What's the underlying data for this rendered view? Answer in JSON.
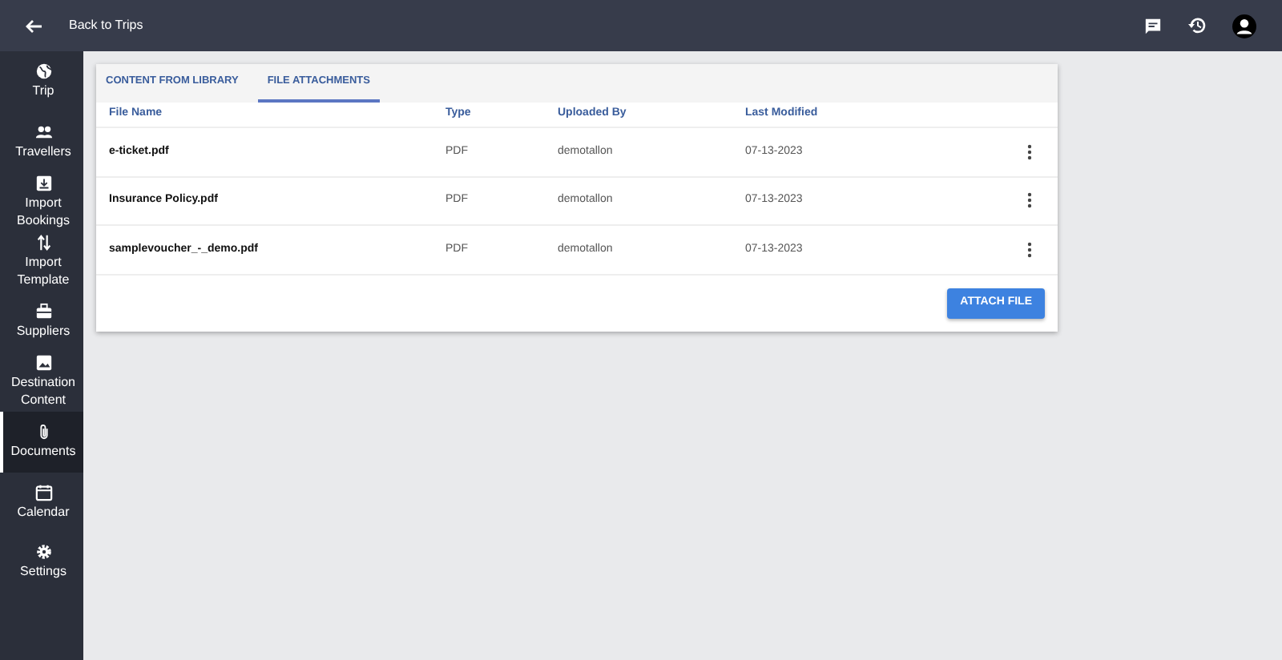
{
  "topbar": {
    "back_label": "Back to Trips"
  },
  "sidebar": {
    "items": [
      {
        "label": "Trip",
        "selected": false
      },
      {
        "label": "Travellers",
        "selected": false
      },
      {
        "label": "Import Bookings",
        "selected": false
      },
      {
        "label": "Import Template",
        "selected": false
      },
      {
        "label": "Suppliers",
        "selected": false
      },
      {
        "label": "Destination Content",
        "selected": false
      },
      {
        "label": "Documents",
        "selected": true
      },
      {
        "label": "Calendar",
        "selected": false
      },
      {
        "label": "Settings",
        "selected": false
      }
    ]
  },
  "tabs": [
    {
      "label": "CONTENT FROM LIBRARY",
      "selected": false
    },
    {
      "label": "FILE ATTACHMENTS",
      "selected": true
    }
  ],
  "table": {
    "columns": [
      "File Name",
      "Type",
      "Uploaded By",
      "Last Modified"
    ],
    "rows": [
      {
        "file_name": "e-ticket.pdf",
        "type": "PDF",
        "uploaded_by": "demotallon",
        "last_modified": "07-13-2023"
      },
      {
        "file_name": "Insurance Policy.pdf",
        "type": "PDF",
        "uploaded_by": "demotallon",
        "last_modified": "07-13-2023"
      },
      {
        "file_name": "samplevoucher_-_demo.pdf",
        "type": "PDF",
        "uploaded_by": "demotallon",
        "last_modified": "07-13-2023"
      }
    ]
  },
  "attach_button": "ATTACH FILE"
}
